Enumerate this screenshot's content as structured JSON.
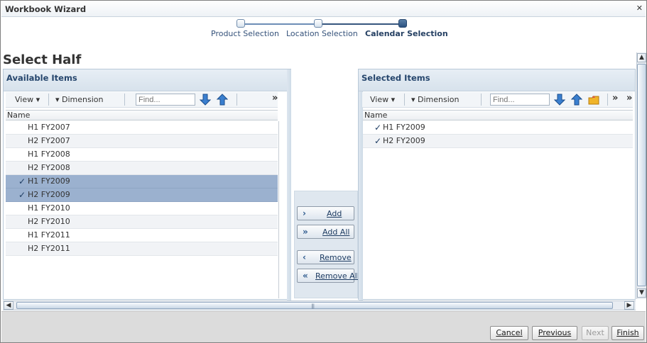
{
  "window": {
    "title": "Workbook Wizard",
    "close_glyph": "✕"
  },
  "train": {
    "steps": [
      {
        "label": "Product Selection",
        "state": "visited"
      },
      {
        "label": "Location Selection",
        "state": "visited"
      },
      {
        "label": "Calendar Selection",
        "state": "current"
      }
    ]
  },
  "page": {
    "title": "Select Half"
  },
  "available": {
    "title": "Available Items",
    "toolbar": {
      "view_label": "View ▾",
      "dimension_label": "▾ Dimension",
      "find_placeholder": "Find...",
      "more_glyph": "»"
    },
    "column_header": "Name",
    "rows": [
      {
        "label": "H1 FY2007",
        "selected": false,
        "check": ""
      },
      {
        "label": "H2 FY2007",
        "selected": false,
        "check": ""
      },
      {
        "label": "H1 FY2008",
        "selected": false,
        "check": ""
      },
      {
        "label": "H2 FY2008",
        "selected": false,
        "check": ""
      },
      {
        "label": "H1 FY2009",
        "selected": true,
        "check": "✓"
      },
      {
        "label": "H2 FY2009",
        "selected": true,
        "check": "✓"
      },
      {
        "label": "H1 FY2010",
        "selected": false,
        "check": ""
      },
      {
        "label": "H2 FY2010",
        "selected": false,
        "check": ""
      },
      {
        "label": "H1 FY2011",
        "selected": false,
        "check": ""
      },
      {
        "label": "H2 FY2011",
        "selected": false,
        "check": ""
      }
    ]
  },
  "selected": {
    "title": "Selected Items",
    "toolbar": {
      "view_label": "View ▾",
      "dimension_label": "▾ Dimension",
      "find_placeholder": "Find...",
      "more_glyph": "»",
      "overflow_glyph": "»"
    },
    "column_header": "Name",
    "rows": [
      {
        "label": "H1 FY2009",
        "check": "✓"
      },
      {
        "label": "H2 FY2009",
        "check": "✓"
      }
    ]
  },
  "shuttle": {
    "add": {
      "label": "Add",
      "icon": "›"
    },
    "add_all": {
      "label": "Add All",
      "icon": "»"
    },
    "remove": {
      "label": "Remove",
      "icon": "‹"
    },
    "remove_all": {
      "label": "Remove All",
      "icon": "«"
    }
  },
  "scroll": {
    "left": "◀",
    "right": "▶",
    "up": "▲",
    "down": "▼",
    "grip": "|||"
  },
  "footer": {
    "cancel": "Cancel",
    "previous": "Previous",
    "next": "Next",
    "finish": "Finish"
  },
  "colors": {
    "accent": "#26466d",
    "selection": "#9bb1cf"
  }
}
